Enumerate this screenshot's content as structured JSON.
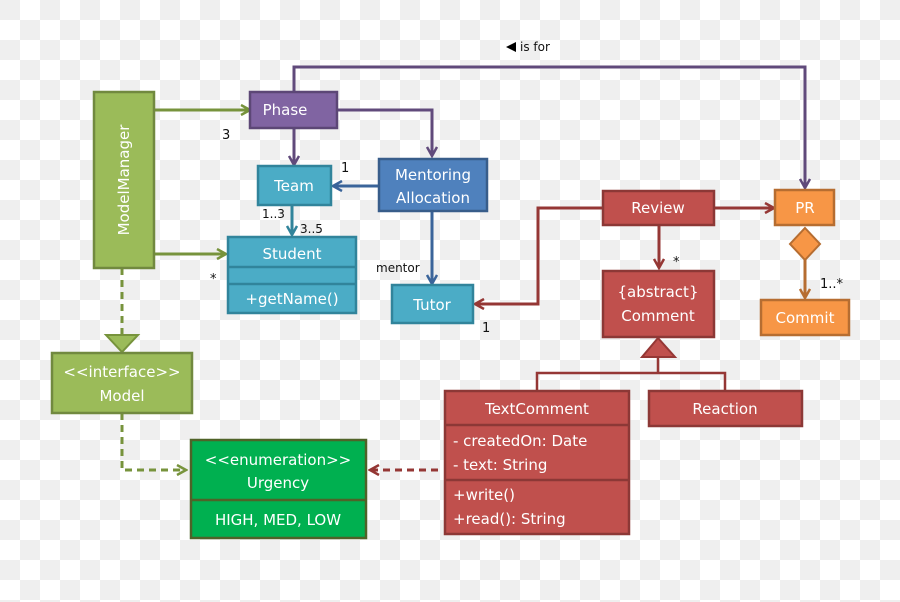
{
  "colors": {
    "model_green": "#9bbb59",
    "model_green_border": "#71893f",
    "phase_purple": "#8064a2",
    "phase_purple_border": "#5c4776",
    "teal": "#4bacc6",
    "teal_border": "#31849b",
    "blue": "#4f81bd",
    "blue_border": "#385d8a",
    "red": "#c0504d",
    "red_border": "#8c3836",
    "orange": "#f79646",
    "orange_border": "#b66d31",
    "enum_green": "#00b050",
    "enum_green_border": "#4f6228"
  },
  "classes": {
    "model_manager": "ModelManager",
    "phase": "Phase",
    "team": "Team",
    "student": {
      "name": "Student",
      "methods": [
        "+getName()"
      ]
    },
    "mentoring_allocation": [
      "Mentoring",
      "Allocation"
    ],
    "tutor": "Tutor",
    "review": "Review",
    "pr": "PR",
    "commit": "Commit",
    "comment": [
      "{abstract}",
      "Comment"
    ],
    "text_comment": {
      "name": "TextComment",
      "attributes": [
        "- createdOn: Date",
        "- text: String"
      ],
      "methods": [
        "+write()",
        "+read(): String"
      ]
    },
    "reaction": "Reaction",
    "model": [
      "<<interface>>",
      "Model"
    ],
    "urgency": {
      "stereotype": "<<enumeration>>",
      "name": "Urgency",
      "values": "HIGH, MED, LOW"
    }
  },
  "labels": {
    "is_for": "is for",
    "phase_multiplicity": "3",
    "student_star": "*",
    "team_one": "1",
    "team_student_src": "1..3",
    "team_student_dst": "3..5",
    "mentor_role": "mentor",
    "tutor_one": "1",
    "comment_star": "*",
    "commit_multiplicity": "1..*"
  }
}
